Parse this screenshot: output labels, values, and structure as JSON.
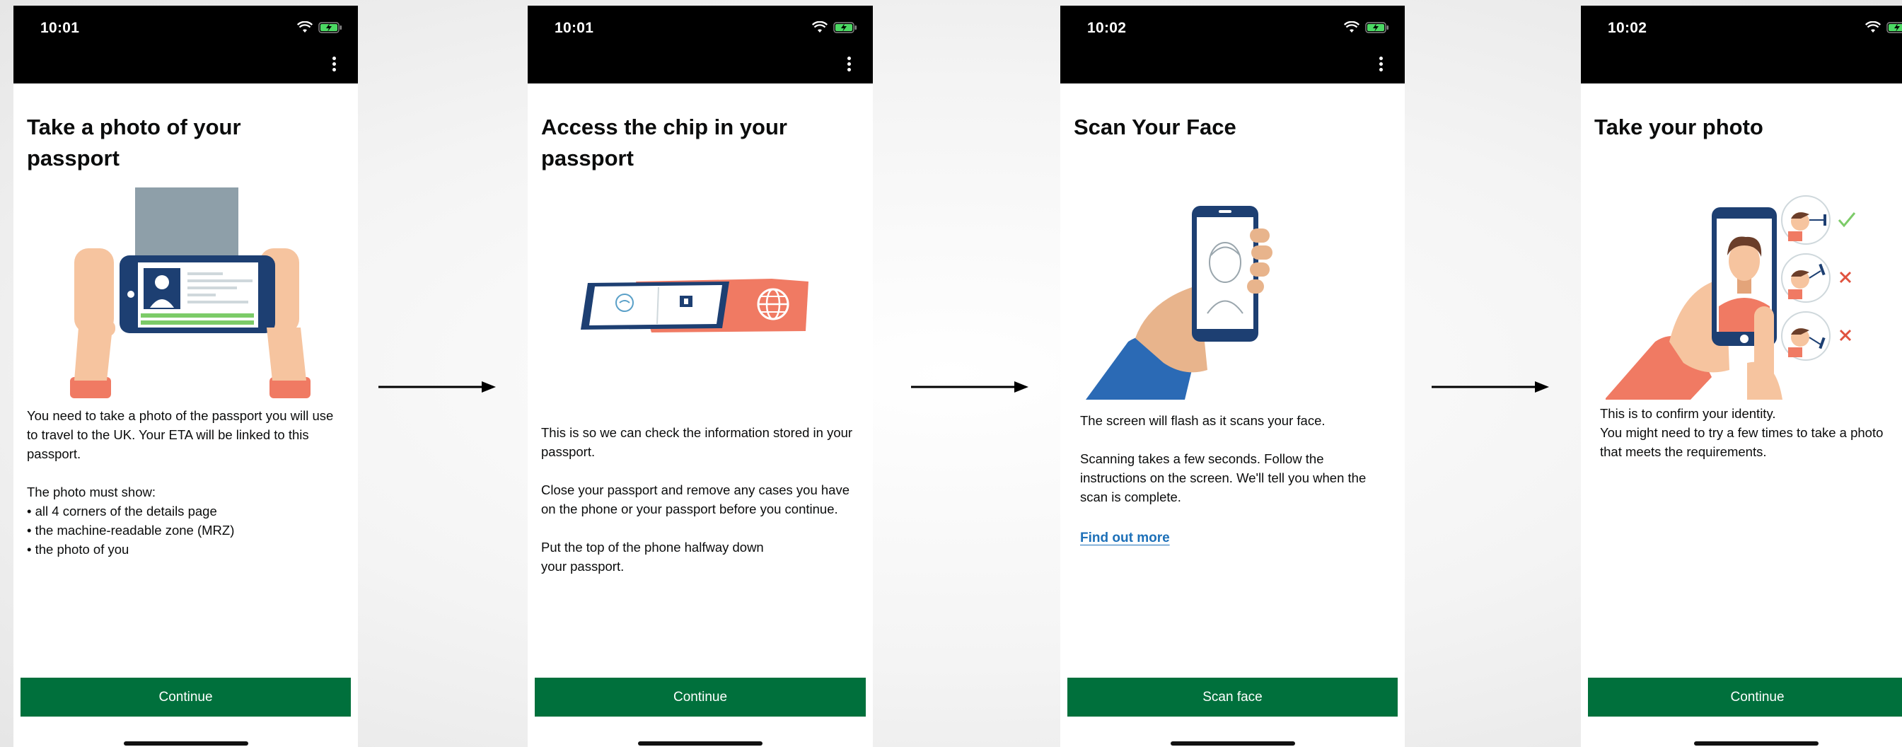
{
  "screens": [
    {
      "time": "10:01",
      "title": "Take a photo of your passport",
      "paragraphs": [
        "You need to take a photo of the passport you will use to travel to the UK. Your ETA will be linked to this passport.",
        "The photo must show:"
      ],
      "bullets": [
        "all 4 corners of the details page",
        "the machine-readable zone (MRZ)",
        "the photo of you"
      ],
      "button": "Continue"
    },
    {
      "time": "10:01",
      "title": "Access the chip in your passport",
      "paragraphs": [
        "This is so we can check the information stored in your passport.",
        "Close your passport and remove any cases you have on the phone or your passport before you continue.",
        "Put the top of the phone halfway down your passport."
      ],
      "button": "Continue"
    },
    {
      "time": "10:02",
      "title": "Scan Your Face",
      "paragraphs": [
        "The screen will flash as it scans your face.",
        "Scanning takes a few seconds. Follow the instructions on the screen. We'll tell you when the scan is complete."
      ],
      "link": "Find out more",
      "button": "Scan face"
    },
    {
      "time": "10:02",
      "title": "Take your photo",
      "paragraphs": [
        "This is to confirm your identity.",
        "You might need to try a few times to take a photo that meets the requirements."
      ],
      "button": "Continue"
    }
  ],
  "icons": {
    "wifi": "wifi-icon",
    "battery": "battery-charging-icon",
    "menu": "more-vertical-icon",
    "arrow": "arrow-right-icon",
    "check": "check-icon",
    "cross": "cross-icon"
  },
  "colors": {
    "status_bar": "#000000",
    "primary_button": "#00703c",
    "link": "#1d70b8",
    "battery": "#4cd964",
    "passport_red": "#f07a63",
    "phone_navy": "#1d3f72",
    "skin": "#f6c49f",
    "sleeve_blue": "#2b6ab5"
  }
}
